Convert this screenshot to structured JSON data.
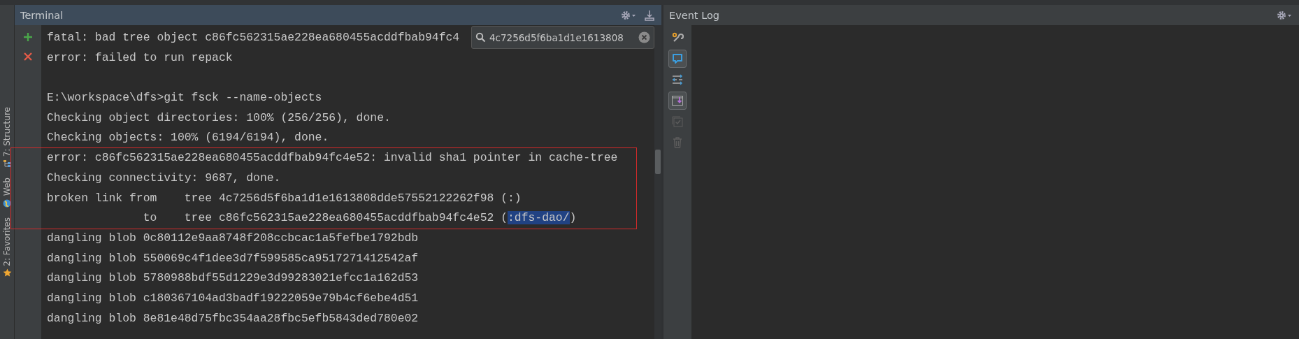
{
  "side_tabs": [
    {
      "label": "7: Structure"
    },
    {
      "label": "Web"
    },
    {
      "label": "2: Favorites"
    }
  ],
  "terminal": {
    "title": "Terminal",
    "search": {
      "value": "4c7256d5f6ba1d1e1613808"
    },
    "earlier_lines": [
      [
        {
          "text": "fatal: bad tree object c86fc562315ae228ea680455acddfbab94fc4",
          "selected": false
        }
      ],
      [
        {
          "text": "error: failed to run repack",
          "selected": false
        }
      ]
    ],
    "command_lines": [
      [
        {
          "text": "E:\\workspace\\dfs>git fsck --name-objects",
          "selected": false
        }
      ],
      [
        {
          "text": "Checking object directories: 100% (256/256), done.",
          "selected": false
        }
      ],
      [
        {
          "text": "Checking objects: 100% (6194/6194), done.",
          "selected": false
        }
      ]
    ],
    "boxed_lines": [
      [
        {
          "text": "error: c86fc562315ae228ea680455acddfbab94fc4e52: invalid sha1 pointer in cache-tree",
          "selected": false
        }
      ],
      [
        {
          "text": "Checking connectivity: 9687, done.",
          "selected": false
        }
      ],
      [
        {
          "text": "broken link from    tree 4c7256d5f6ba1d1e1613808dde57552122262f98 (:)",
          "selected": false
        }
      ],
      [
        {
          "text": "              to    tree c86fc562315ae228ea680455acddfbab94fc4e52 (",
          "selected": false
        },
        {
          "text": ":dfs-dao/",
          "selected": true
        },
        {
          "text": ")",
          "selected": false
        }
      ]
    ],
    "later_lines": [
      [
        {
          "text": "dangling blob 0c80112e9aa8748f208ccbcac1a5fefbe1792bdb",
          "selected": false
        }
      ],
      [
        {
          "text": "dangling blob 550069c4f1dee3d7f599585ca9517271412542af",
          "selected": false
        }
      ],
      [
        {
          "text": "dangling blob 5780988bdf55d1229e3d99283021efcc1a162d53",
          "selected": false
        }
      ],
      [
        {
          "text": "dangling blob c180367104ad3badf19222059e79b4cf6ebe4d51",
          "selected": false
        }
      ],
      [
        {
          "text": "dangling blob 8e81e48d75fbc354aa28fbc5efb5843ded780e02",
          "selected": false
        }
      ]
    ]
  },
  "event_log": {
    "title": "Event Log",
    "tools": [
      {
        "toggled": false,
        "disabled": false
      },
      {
        "toggled": true,
        "disabled": false
      },
      {
        "toggled": false,
        "disabled": false
      },
      {
        "toggled": true,
        "disabled": false
      },
      {
        "toggled": false,
        "disabled": true
      },
      {
        "toggled": false,
        "disabled": true
      }
    ]
  }
}
